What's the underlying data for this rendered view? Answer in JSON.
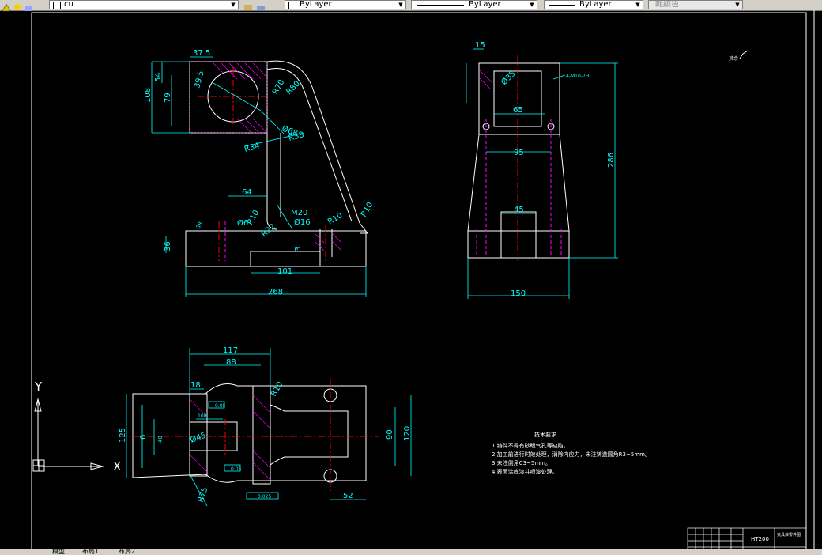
{
  "toolbar": {
    "view_name": "cu",
    "layer_color": "ByLayer",
    "linetype": "ByLayer",
    "lineweight": "ByLayer",
    "plot_style": "随颜色"
  },
  "status_tabs": [
    "模型",
    "布局1",
    "布局2"
  ],
  "drawing": {
    "front_view_dims": {
      "d_37_5": "37.5",
      "d_54": "54",
      "d_108": "108",
      "d_79": "79",
      "d_39_5": "39.5",
      "r_70": "R70",
      "r_80": "R80",
      "dia_68": "Ø68",
      "r_38": "R38",
      "r_34": "R34",
      "d_64": "64",
      "r_10a": "R10",
      "dia_6": "Ø6",
      "r_22": "R22",
      "m20": "M20",
      "dia_16": "Ø16",
      "r_10b": "R10",
      "r_10c": "R10",
      "d_36": "36",
      "d_3": "3",
      "d_101": "101",
      "d_268": "268",
      "d_38": "38"
    },
    "side_view_dims": {
      "d_15": "15",
      "dia_35": "Ø35",
      "hole_note": "4-M10-7H",
      "d_65": "65",
      "d_95": "95",
      "d_45": "45",
      "d_286": "286",
      "d_150": "150"
    },
    "top_view_dims": {
      "d_117": "117",
      "d_88": "88",
      "d_18": "18",
      "r_10": "R10",
      "d_125": "125",
      "d_6": "6",
      "d_100": "100",
      "dia_45": "Ø45",
      "d_90": "90",
      "d_120": "120",
      "d_52": "52",
      "r_75": "R75",
      "d_40": "40",
      "tol_1": "0.05",
      "tol_2": "0.05",
      "tol_3": "0.025"
    },
    "ucs": {
      "x_label": "X",
      "y_label": "Y"
    },
    "tech_requirements": {
      "title": "技术要求",
      "lines": [
        "1.铸件不得有砂眼气孔等缺陷。",
        "2.加工前进行时效处理，消除内应力，未注铸造圆角R3~5mm。",
        "3.未注倒角C3~5mm。",
        "4.表面涂底漆并喷漆处理。"
      ]
    },
    "title_block": {
      "material": "HT200",
      "part_name": "夹具体零件图"
    },
    "corner_mark": "其余"
  },
  "colors": {
    "background": "#000000",
    "geometry": "#ffffff",
    "dimension": "#00ffff",
    "centerline": "#ff0000",
    "hidden": "#ff00ff",
    "hatch": "#ff00ff"
  }
}
